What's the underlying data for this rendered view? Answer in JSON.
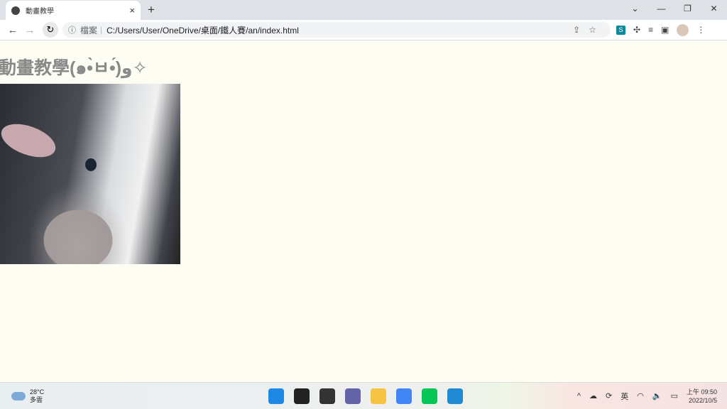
{
  "browser": {
    "tab_title": "動畫教學",
    "address_label": "檔案",
    "url": "C:/Users/User/OneDrive/桌面/鐵人賽/an/index.html",
    "extension_badge": "S"
  },
  "page": {
    "heading": "動畫教學(๑•̀ㅂ•́)و✧"
  },
  "taskbar": {
    "temperature": "28°C",
    "weather": "多雲",
    "ime": "英",
    "time": "上午 09:50",
    "date": "2022/10/5",
    "apps": [
      {
        "name": "start",
        "color": "#1e88e5"
      },
      {
        "name": "search",
        "color": "#222"
      },
      {
        "name": "task-view",
        "color": "#333"
      },
      {
        "name": "teams-chat",
        "color": "#6264a7"
      },
      {
        "name": "file-explorer",
        "color": "#f6c343"
      },
      {
        "name": "chrome",
        "color": "#4285f4"
      },
      {
        "name": "line",
        "color": "#06c755"
      },
      {
        "name": "vscode",
        "color": "#1f8ad2"
      }
    ]
  }
}
